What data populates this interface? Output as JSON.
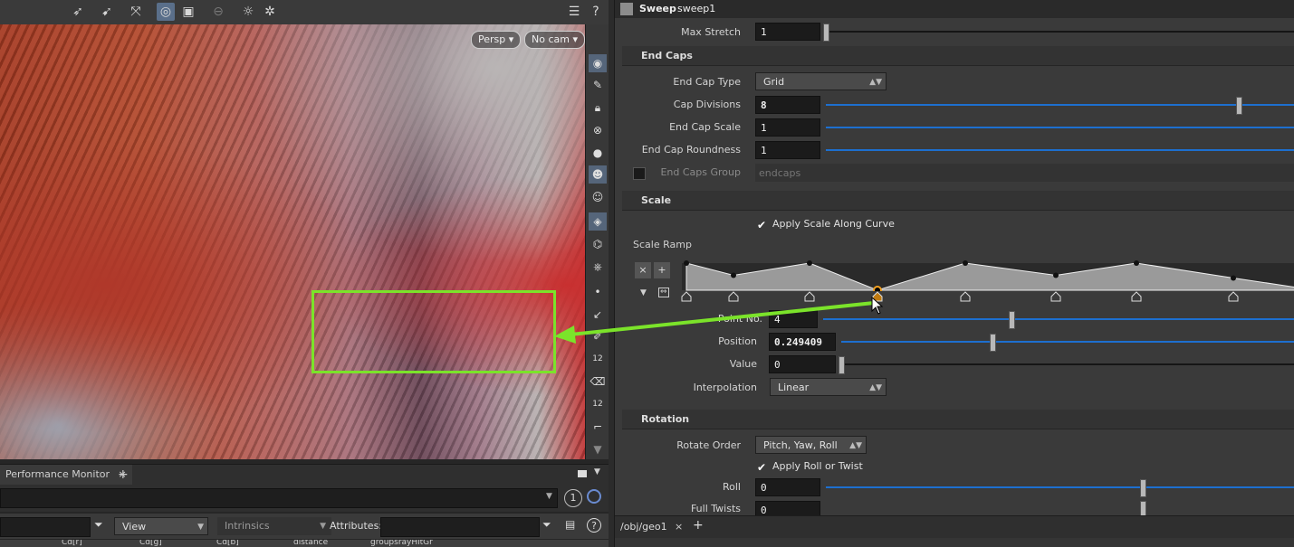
{
  "viewport": {
    "persp_label": "Persp",
    "cam_label": "No cam",
    "colors": {
      "highlight": "#7be32a"
    }
  },
  "toolbar_icons": [
    "select-arrow-icon",
    "select-arrow2-icon",
    "transform-icon",
    "snapshot-icon",
    "camera-icon",
    "disable-icon",
    "lightbulb-icon",
    "gear-icon",
    "display-options-icon",
    "help-icon"
  ],
  "side_icons": [
    "view-icon",
    "pen-icon",
    "lock-icon",
    "ghost-icon",
    "sphere-icon",
    "skull-icon",
    "skull2-icon",
    "render-icon",
    "camera-rig-icon",
    "render2-icon",
    "point-icon",
    "brush-icon",
    "pencil-icon",
    "handle-icon",
    "paint-icon",
    "paint2-icon",
    "corner-icon",
    "arrow-down-icon"
  ],
  "side_numbers": {
    "n1": "12",
    "n2": "12"
  },
  "bottom_left": {
    "tab_label": "Performance Monitor",
    "tab_close": "×",
    "tab_add": "+",
    "badge": "1",
    "view_label": "View",
    "intrinsics_label": "Intrinsics",
    "attributes_label": "Attributes:",
    "columns": [
      "Cd[r]",
      "Cd[g]",
      "Cd[b]",
      "distance",
      "groupsrayHitGr"
    ]
  },
  "header": {
    "node_type": "Sweep",
    "node_name": "sweep1"
  },
  "params": {
    "max_stretch": {
      "label": "Max Stretch",
      "value": "1"
    },
    "end_caps": {
      "title": "End Caps",
      "type": {
        "label": "End Cap Type",
        "value": "Grid"
      },
      "divisions": {
        "label": "Cap Divisions",
        "value": "8"
      },
      "scale": {
        "label": "End Cap Scale",
        "value": "1"
      },
      "roundness": {
        "label": "End Cap Roundness",
        "value": "1"
      },
      "group": {
        "label": "End Caps Group",
        "placeholder": "endcaps"
      }
    },
    "scale": {
      "title": "Scale",
      "apply_label": "Apply Scale Along Curve",
      "ramp_label": "Scale Ramp",
      "point_no": {
        "label": "Point No.",
        "value": "4"
      },
      "position": {
        "label": "Position",
        "value": "0.249409"
      },
      "value": {
        "label": "Value",
        "value": "0"
      },
      "interpolation": {
        "label": "Interpolation",
        "value": "Linear"
      },
      "ramp_points": [
        1,
        0.55,
        1,
        0,
        1,
        0.55,
        1,
        0.45,
        0
      ]
    },
    "rotation": {
      "title": "Rotation",
      "rotate_order": {
        "label": "Rotate Order",
        "value": "Pitch, Yaw, Roll"
      },
      "apply_roll_label": "Apply Roll or Twist",
      "roll": {
        "label": "Roll",
        "value": "0"
      },
      "full_twists": {
        "label": "Full Twists",
        "value": "0"
      }
    }
  },
  "footer": {
    "path": "/obj/geo1",
    "close": "×",
    "add": "+"
  }
}
